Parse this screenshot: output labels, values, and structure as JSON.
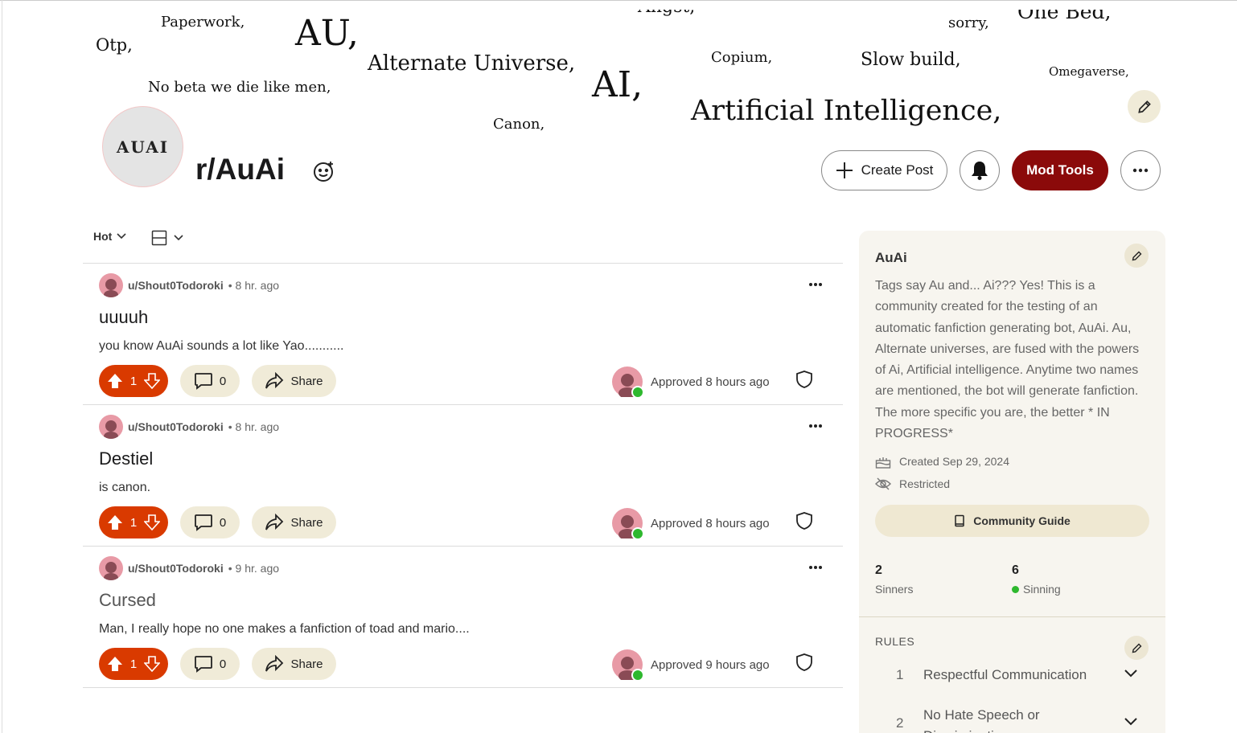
{
  "banner": {
    "words": [
      "Paperwork,",
      "Otp,",
      "AU,",
      "Alternate Universe,",
      "Angst,",
      "Copium,",
      "Slow build,",
      "sorry,",
      "One Bed,",
      "Omegaverse,",
      "No beta we die like men,",
      "AI,",
      "Canon,",
      "Artificial Intelligence,"
    ]
  },
  "header": {
    "avatar_text": "AUAI",
    "subreddit_name": "r/AuAi",
    "create_post_label": "Create Post",
    "mod_tools_label": "Mod Tools"
  },
  "feed": {
    "sort_label": "Hot"
  },
  "posts": [
    {
      "user": "u/Shout0Todoroki",
      "time": "• 8 hr. ago",
      "title": "uuuuh",
      "body": "you know AuAi sounds a lot like Yao...........",
      "votes": "1",
      "comments": "0",
      "share_label": "Share",
      "approved": "Approved 8 hours ago"
    },
    {
      "user": "u/Shout0Todoroki",
      "time": "• 8 hr. ago",
      "title": "Destiel",
      "body": "is canon.",
      "votes": "1",
      "comments": "0",
      "share_label": "Share",
      "approved": "Approved 8 hours ago"
    },
    {
      "user": "u/Shout0Todoroki",
      "time": "• 9 hr. ago",
      "title": "Cursed",
      "body": "Man, I really hope no one makes a fanfiction of toad and mario....",
      "votes": "1",
      "comments": "0",
      "share_label": "Share",
      "approved": "Approved 9 hours ago"
    }
  ],
  "sidebar": {
    "title": "AuAi",
    "description": "Tags say Au and... Ai??? Yes! This is a community created for the testing of an automatic fanfiction generating bot, AuAi. Au, Alternate universes, are fused with the powers of Ai, Artificial intelligence. Anytime two names are mentioned, the bot will generate fanfiction. The more specific you are, the better * IN PROGRESS*",
    "created": "Created Sep 29, 2024",
    "visibility": "Restricted",
    "guide_label": "Community Guide",
    "members_count": "2",
    "members_label": "Sinners",
    "online_count": "6",
    "online_label": "Sinning",
    "rules_header": "RULES",
    "rules": [
      {
        "num": "1",
        "text": "Respectful Communication"
      },
      {
        "num": "2",
        "text": "No Hate Speech or Discrimination"
      }
    ]
  },
  "colors": {
    "mod_tools_bg": "#8b0a0a",
    "vote_bg": "#d93a00",
    "pill_bg": "#f0ebd8",
    "sidebar_bg": "#f7f5ef",
    "online_dot": "#2eb82e"
  }
}
